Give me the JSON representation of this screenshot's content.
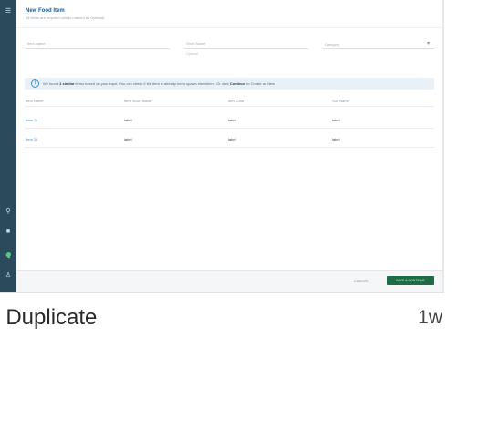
{
  "form": {
    "title": "New Food Item",
    "subtitle": "All fields are required unless marked as Optional",
    "fields": {
      "item_name_label": "Item Name",
      "short_name_label": "Short Name",
      "short_name_hint": "Optional",
      "category_placeholder": "Category"
    }
  },
  "banner": {
    "prefix": "We found ",
    "count": "2 similar",
    "middle": " items based on your input. You can check if the item is already been spawn elsewhere. Or click ",
    "action": "Continue",
    "suffix": " to Create as New"
  },
  "table": {
    "headers": [
      "Item Name",
      "Item Short Name",
      "Item Code",
      "Sub Name"
    ],
    "rows": [
      {
        "name": "Item 11",
        "short_name": "label",
        "code": "label",
        "sub_name": "label"
      },
      {
        "name": "Item 21",
        "short_name": "label",
        "code": "label",
        "sub_name": "label"
      }
    ]
  },
  "footer": {
    "cancel_label": "CANCEL",
    "save_label": "SAVE & CONTINUE"
  },
  "card": {
    "caption": "f Duplicate",
    "timestamp": "1w"
  },
  "icons": {
    "sidebar": [
      "menu-icon",
      "search-icon",
      "grid-icon",
      "chat-icon",
      "user-icon"
    ]
  },
  "colors": {
    "sidebar": "#2b4a5c",
    "title": "#1c5c8c",
    "link": "#3d8fd0",
    "primary_button": "#1f6b45",
    "status_dot": "#4ccf7a"
  }
}
